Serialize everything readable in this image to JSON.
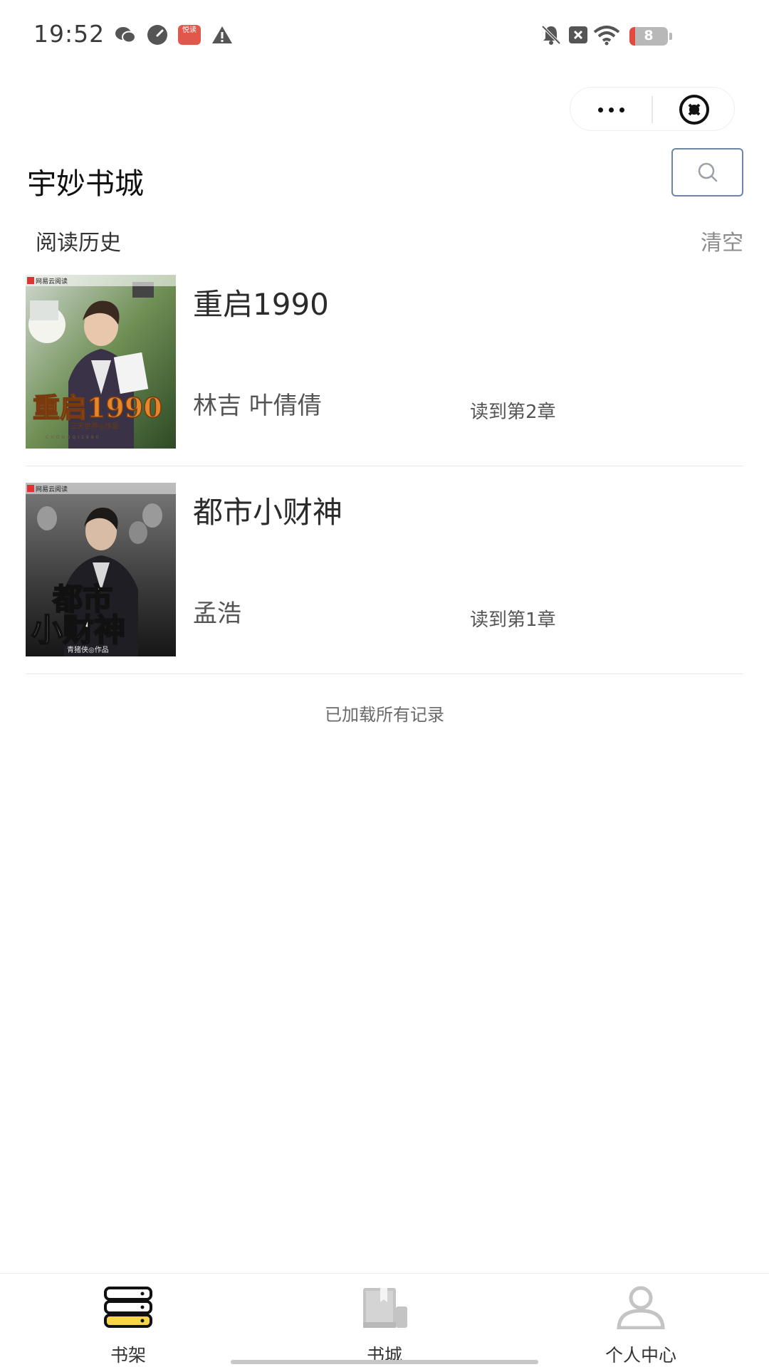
{
  "status_bar": {
    "time": "19:52",
    "battery_level": "8",
    "reader_app_label": "悦读"
  },
  "capsule": {
    "more": "more-menu",
    "close": "close-miniprogram"
  },
  "header": {
    "title": "宇妙书城",
    "search_icon": "search-icon"
  },
  "history": {
    "section_title": "阅读历史",
    "clear_label": "清空",
    "books": [
      {
        "title": "重启1990",
        "author": "林吉 叶倩倩",
        "progress": "读到第2章",
        "cover_publisher": "网易云阅读",
        "cover_title": "重启1990",
        "cover_credit": "三天世界◎作品",
        "cover_pinyin": "CHONGQI1990"
      },
      {
        "title": "都市小财神",
        "author": "孟浩",
        "progress": "读到第1章",
        "cover_publisher": "网易云阅读",
        "cover_title_line1": "都市",
        "cover_title_line2": "小财神",
        "cover_credit": "青猪侠◎作品"
      }
    ],
    "end_text": "已加载所有记录"
  },
  "tab_bar": {
    "tabs": [
      {
        "label": "书架",
        "icon": "bookshelf-icon",
        "active": true
      },
      {
        "label": "书城",
        "icon": "bookstore-icon",
        "active": false
      },
      {
        "label": "个人中心",
        "icon": "profile-icon",
        "active": false
      }
    ]
  },
  "colors": {
    "accent_yellow": "#f7d64a",
    "icon_gray": "#c4c4c4",
    "search_border": "#6c86a5"
  }
}
